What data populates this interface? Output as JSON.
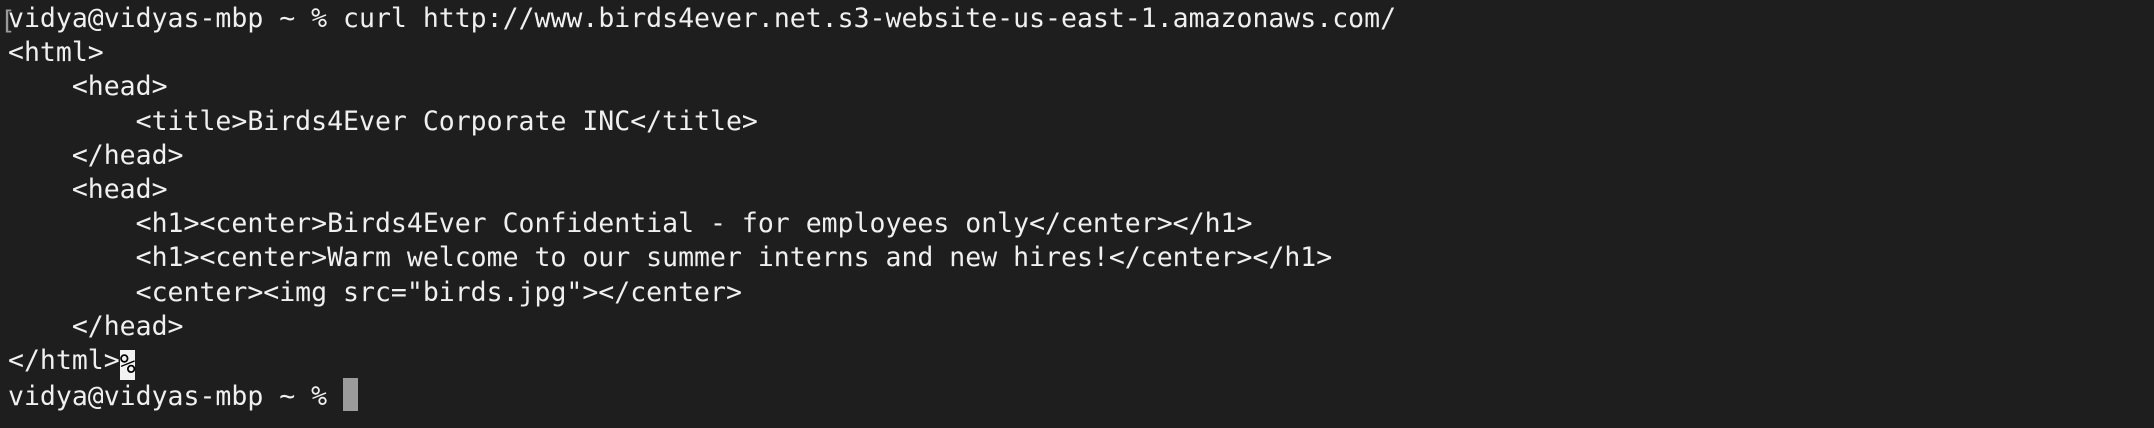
{
  "terminal": {
    "prompt": "vidya@vidyas-mbp ~ % ",
    "command": "curl http://www.birds4ever.net.s3-website-us-east-1.amazonaws.com/",
    "output": [
      "<html>",
      "    <head>",
      "        <title>Birds4Ever Corporate INC</title>",
      "    </head>",
      "    <head>",
      "        <h1><center>Birds4Ever Confidential - for employees only</center></h1>",
      "        <h1><center>Warm welcome to our summer interns and new hires!</center></h1>",
      "        <center><img src=\"birds.jpg\"></center>",
      "    </head>",
      "</html>"
    ],
    "eol_marker": "%",
    "final_prompt": "vidya@vidyas-mbp ~ % "
  }
}
